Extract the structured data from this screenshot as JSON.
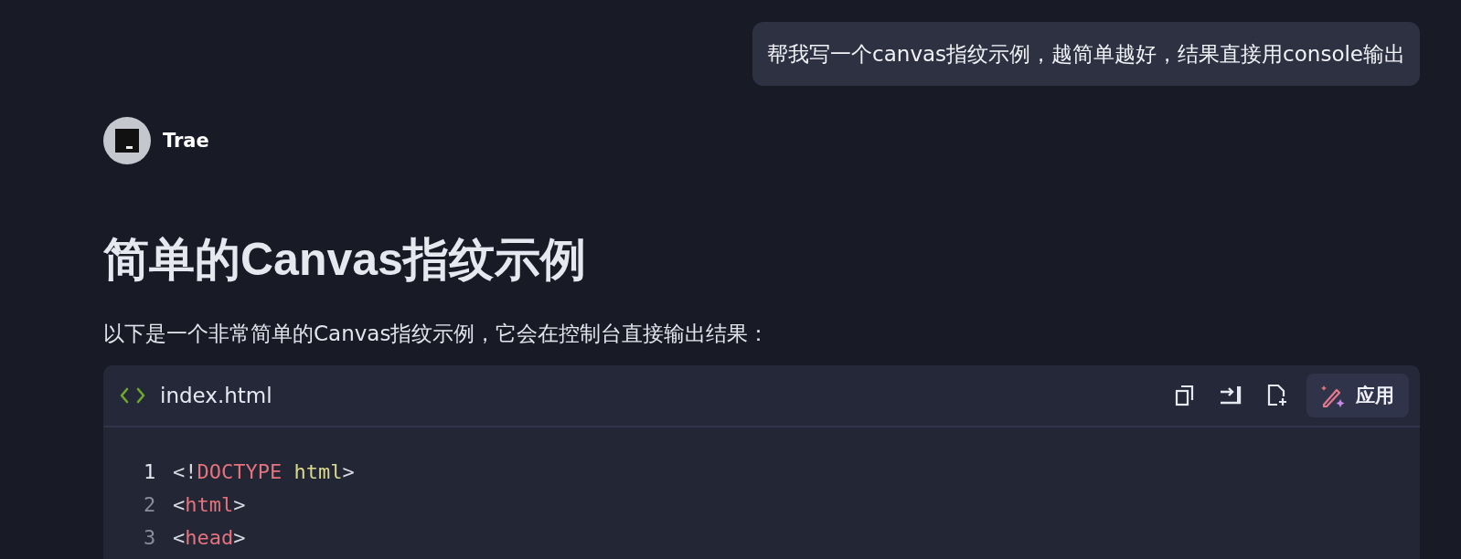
{
  "user_message": "帮我写一个canvas指纹示例，越简单越好，结果直接用console输出",
  "assistant": {
    "name": "Trae"
  },
  "heading": "简单的Canvas指纹示例",
  "paragraph": "以下是一个非常简单的Canvas指纹示例，它会在控制台直接输出结果：",
  "code_block": {
    "file_name": "index.html",
    "apply_button": "应用",
    "lines": [
      {
        "number": "1",
        "active": true,
        "tokens": [
          {
            "kind": "punct",
            "text": "<!"
          },
          {
            "kind": "tag",
            "text": "DOCTYPE"
          },
          {
            "kind": "attr",
            "text": "html"
          },
          {
            "kind": "punct",
            "text": ">"
          }
        ]
      },
      {
        "number": "2",
        "active": false,
        "tokens": [
          {
            "kind": "punct",
            "text": "<"
          },
          {
            "kind": "tag",
            "text": "html"
          },
          {
            "kind": "punct",
            "text": ">"
          }
        ]
      },
      {
        "number": "3",
        "active": false,
        "tokens": [
          {
            "kind": "punct",
            "text": "<"
          },
          {
            "kind": "tag",
            "text": "head"
          },
          {
            "kind": "punct",
            "text": ">"
          }
        ]
      }
    ]
  }
}
